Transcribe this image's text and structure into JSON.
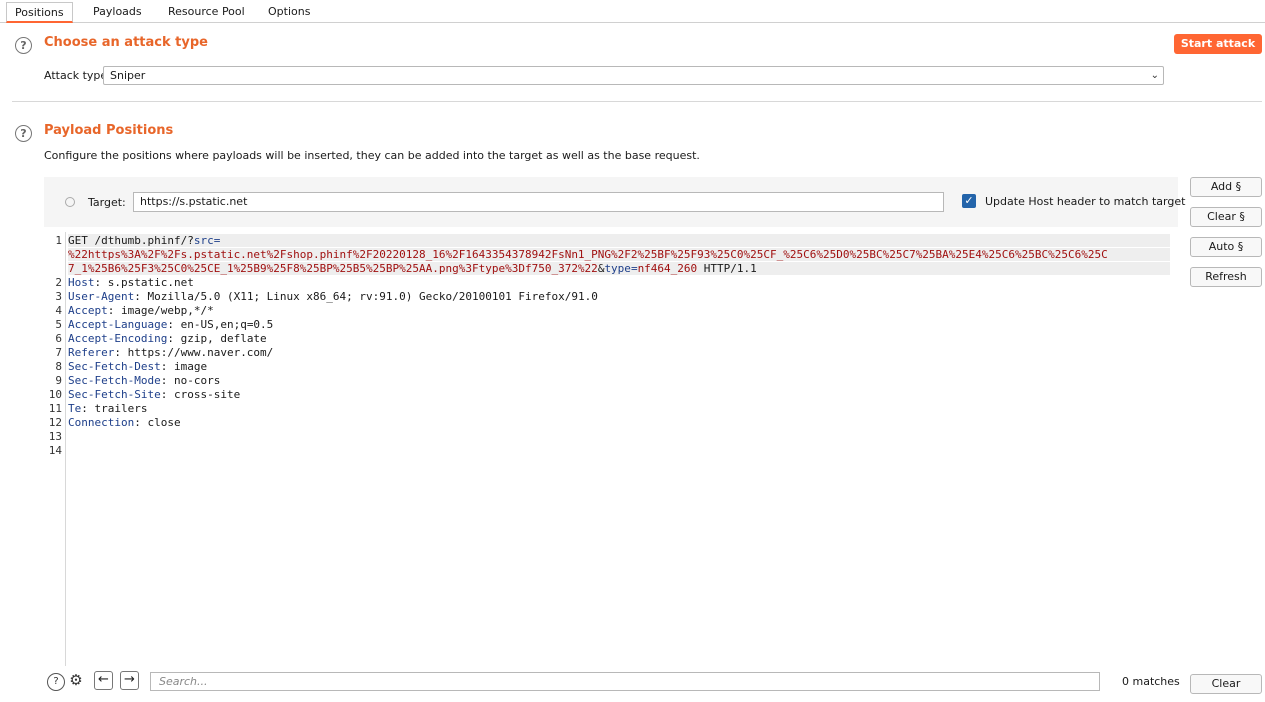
{
  "tabs": [
    "Positions",
    "Payloads",
    "Resource Pool",
    "Options"
  ],
  "attack_section": {
    "title": "Choose an attack type",
    "start_button": "Start attack",
    "attack_type_label": "Attack type:",
    "attack_type_value": "Sniper"
  },
  "positions_section": {
    "title": "Payload Positions",
    "description": "Configure the positions where payloads will be inserted, they can be added into the target as well as the base request.",
    "target_label": "Target:",
    "target_value": "https://s.pstatic.net",
    "update_host_label": "Update Host header to match target",
    "update_host_checked": true
  },
  "side_buttons": [
    "Add §",
    "Clear §",
    "Auto §",
    "Refresh"
  ],
  "request": {
    "line1_method": "GET /dthumb.phinf/?",
    "line1_param1": "src",
    "line1_eq1": "=",
    "line1_payload": "%22https%3A%2F%2Fs.pstatic.net%2Fshop.phinf%2F20220128_16%2F1643354378942FsNn1_PNG%2F2%25BF%25F93%25C0%25CF_%25C6%25D0%25BC%25C7%25BA%25E4%25C6%25BC%25C6%25C",
    "line1_payload_cont": "7_1%25B6%25F3%25C0%25CE_1%25B9%25F8%25BP%25B5%25BP%25AA.png%3Ftype%3Df750_372%22",
    "line1_amp": "&",
    "line1_param2": "type",
    "line1_eq2": "=",
    "line1_val2": "nf464_260",
    "line1_proto": " HTTP/1.1",
    "headers": [
      {
        "key": "Host",
        "value": ": s.pstatic.net"
      },
      {
        "key": "User-Agent",
        "value": ": Mozilla/5.0 (X11; Linux x86_64; rv:91.0) Gecko/20100101 Firefox/91.0"
      },
      {
        "key": "Accept",
        "value": ": image/webp,*/*"
      },
      {
        "key": "Accept-Language",
        "value": ": en-US,en;q=0.5"
      },
      {
        "key": "Accept-Encoding",
        "value": ": gzip, deflate"
      },
      {
        "key": "Referer",
        "value": ": https://www.naver.com/"
      },
      {
        "key": "Sec-Fetch-Dest",
        "value": ": image"
      },
      {
        "key": "Sec-Fetch-Mode",
        "value": ": no-cors"
      },
      {
        "key": "Sec-Fetch-Site",
        "value": ": cross-site"
      },
      {
        "key": "Te",
        "value": ": trailers"
      },
      {
        "key": "Connection",
        "value": ": close"
      }
    ],
    "line_numbers": [
      "1",
      "2",
      "3",
      "4",
      "5",
      "6",
      "7",
      "8",
      "9",
      "10",
      "11",
      "12",
      "13",
      "14"
    ]
  },
  "search": {
    "placeholder": "Search...",
    "matches": "0 matches",
    "clear_button": "Clear"
  },
  "colors": {
    "accent": "#ff6633",
    "title": "#e8662a",
    "header_key": "#1e3f8a",
    "payload": "#a01010"
  }
}
